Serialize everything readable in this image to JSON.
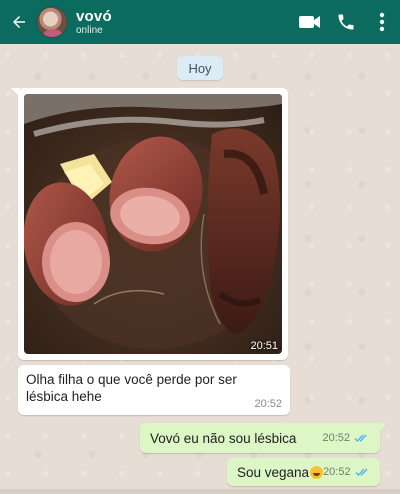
{
  "header": {
    "contact_name": "vovó",
    "status": "online",
    "icons": [
      "back-arrow-icon",
      "video-call-icon",
      "phone-icon",
      "more-vert-icon"
    ]
  },
  "date_chip": "Hoy",
  "messages": {
    "image_message": {
      "time": "20:51"
    },
    "incoming_text": {
      "text": "Olha filha o que você perde por ser lésbica hehe",
      "time": "20:52"
    },
    "outgoing": [
      {
        "text": "Vovó eu não sou lésbica",
        "time": "20:52",
        "ticks": "double-check-read"
      },
      {
        "text": "Sou vegana",
        "emoji": "rolling-laughing-emoji",
        "time": "20:52",
        "ticks": "double-check-read"
      }
    ]
  },
  "colors": {
    "header": "#0b6b5e",
    "chat_background": "#e6ddd4",
    "outgoing_bubble": "#dcf6c6",
    "read_ticks": "#4fb6ec"
  }
}
